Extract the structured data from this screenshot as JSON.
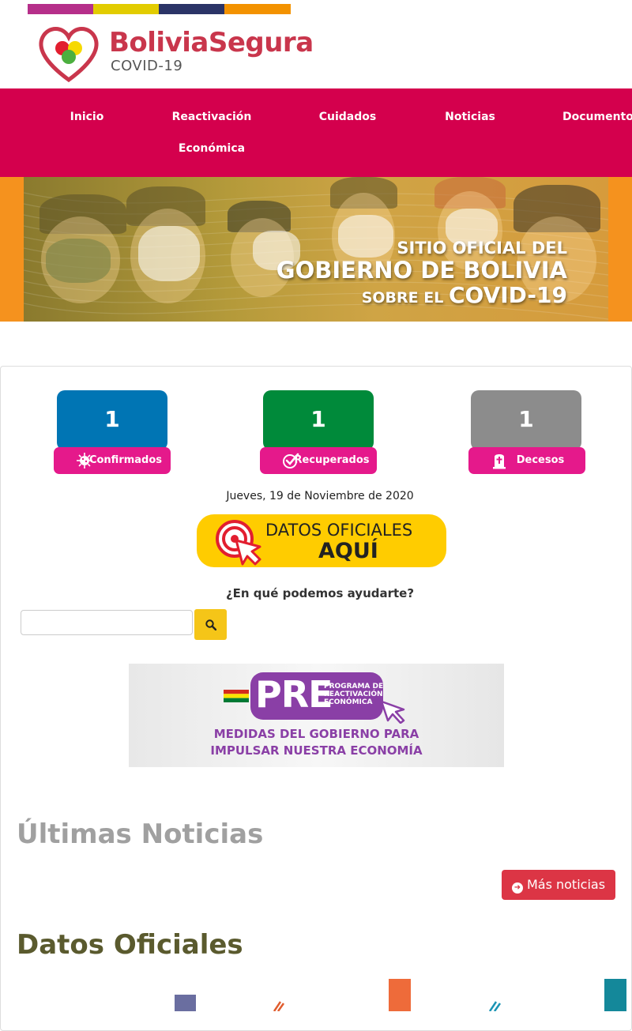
{
  "header": {
    "brand_stripes": [
      "#b62f8a",
      "#e2cc00",
      "#2b3467",
      "#f39200"
    ],
    "logo_title": "BoliviaSegura",
    "logo_subtitle": "COVID-19",
    "logo_colors": {
      "heart": "#c9364c",
      "red": "#e21e2f",
      "yellow": "#f6d900",
      "green": "#4caf3f"
    }
  },
  "nav": {
    "background": "#d4004d",
    "items": [
      {
        "label": "Inicio"
      },
      {
        "label": "Reactivación",
        "label2": "Económica"
      },
      {
        "label": "Cuidados"
      },
      {
        "label": "Noticias"
      },
      {
        "label": "Documentos"
      }
    ]
  },
  "hero": {
    "line1": "SITIO OFICIAL DEL",
    "line2": "GOBIERNO DE BOLIVIA",
    "line3_small": "SOBRE EL",
    "line3_big": "COVID-19",
    "side_color": "#f5921e"
  },
  "stats": [
    {
      "value": "1",
      "label": "Confirmados",
      "color": "#0075b4",
      "icon": "virus-icon"
    },
    {
      "value": "1",
      "label": "Recuperados",
      "color": "#008a3a",
      "icon": "check-circle-icon"
    },
    {
      "value": "1",
      "label": "Decesos",
      "color": "#8c8c8c",
      "icon": "tomb-icon"
    }
  ],
  "stat_label_color": "#e5198b",
  "date_text": "Jueves, 19 de Noviembre de 2020",
  "datos_button": {
    "line1": "DATOS OFICIALES",
    "line2": "AQUÍ",
    "color": "#ffcc00"
  },
  "search": {
    "heading": "¿En qué podemos ayudarte?",
    "value": "",
    "placeholder": "",
    "button_icon": "search-icon"
  },
  "pre_banner": {
    "acronym": "PRE",
    "description": "PROGRAMA DE\nREACTIVACIÓN\nECONÓMICA",
    "line1": "MEDIDAS DEL GOBIERNO PARA",
    "line2": "IMPULSAR NUESTRA ECONOMÍA",
    "accent": "#8a3fa6"
  },
  "news": {
    "heading": "Últimas Noticias",
    "more_button": "Más noticias",
    "more_icon": "arrow-circle-right-icon",
    "button_color": "#dc3545"
  },
  "datos": {
    "heading": "Datos Oficiales"
  }
}
